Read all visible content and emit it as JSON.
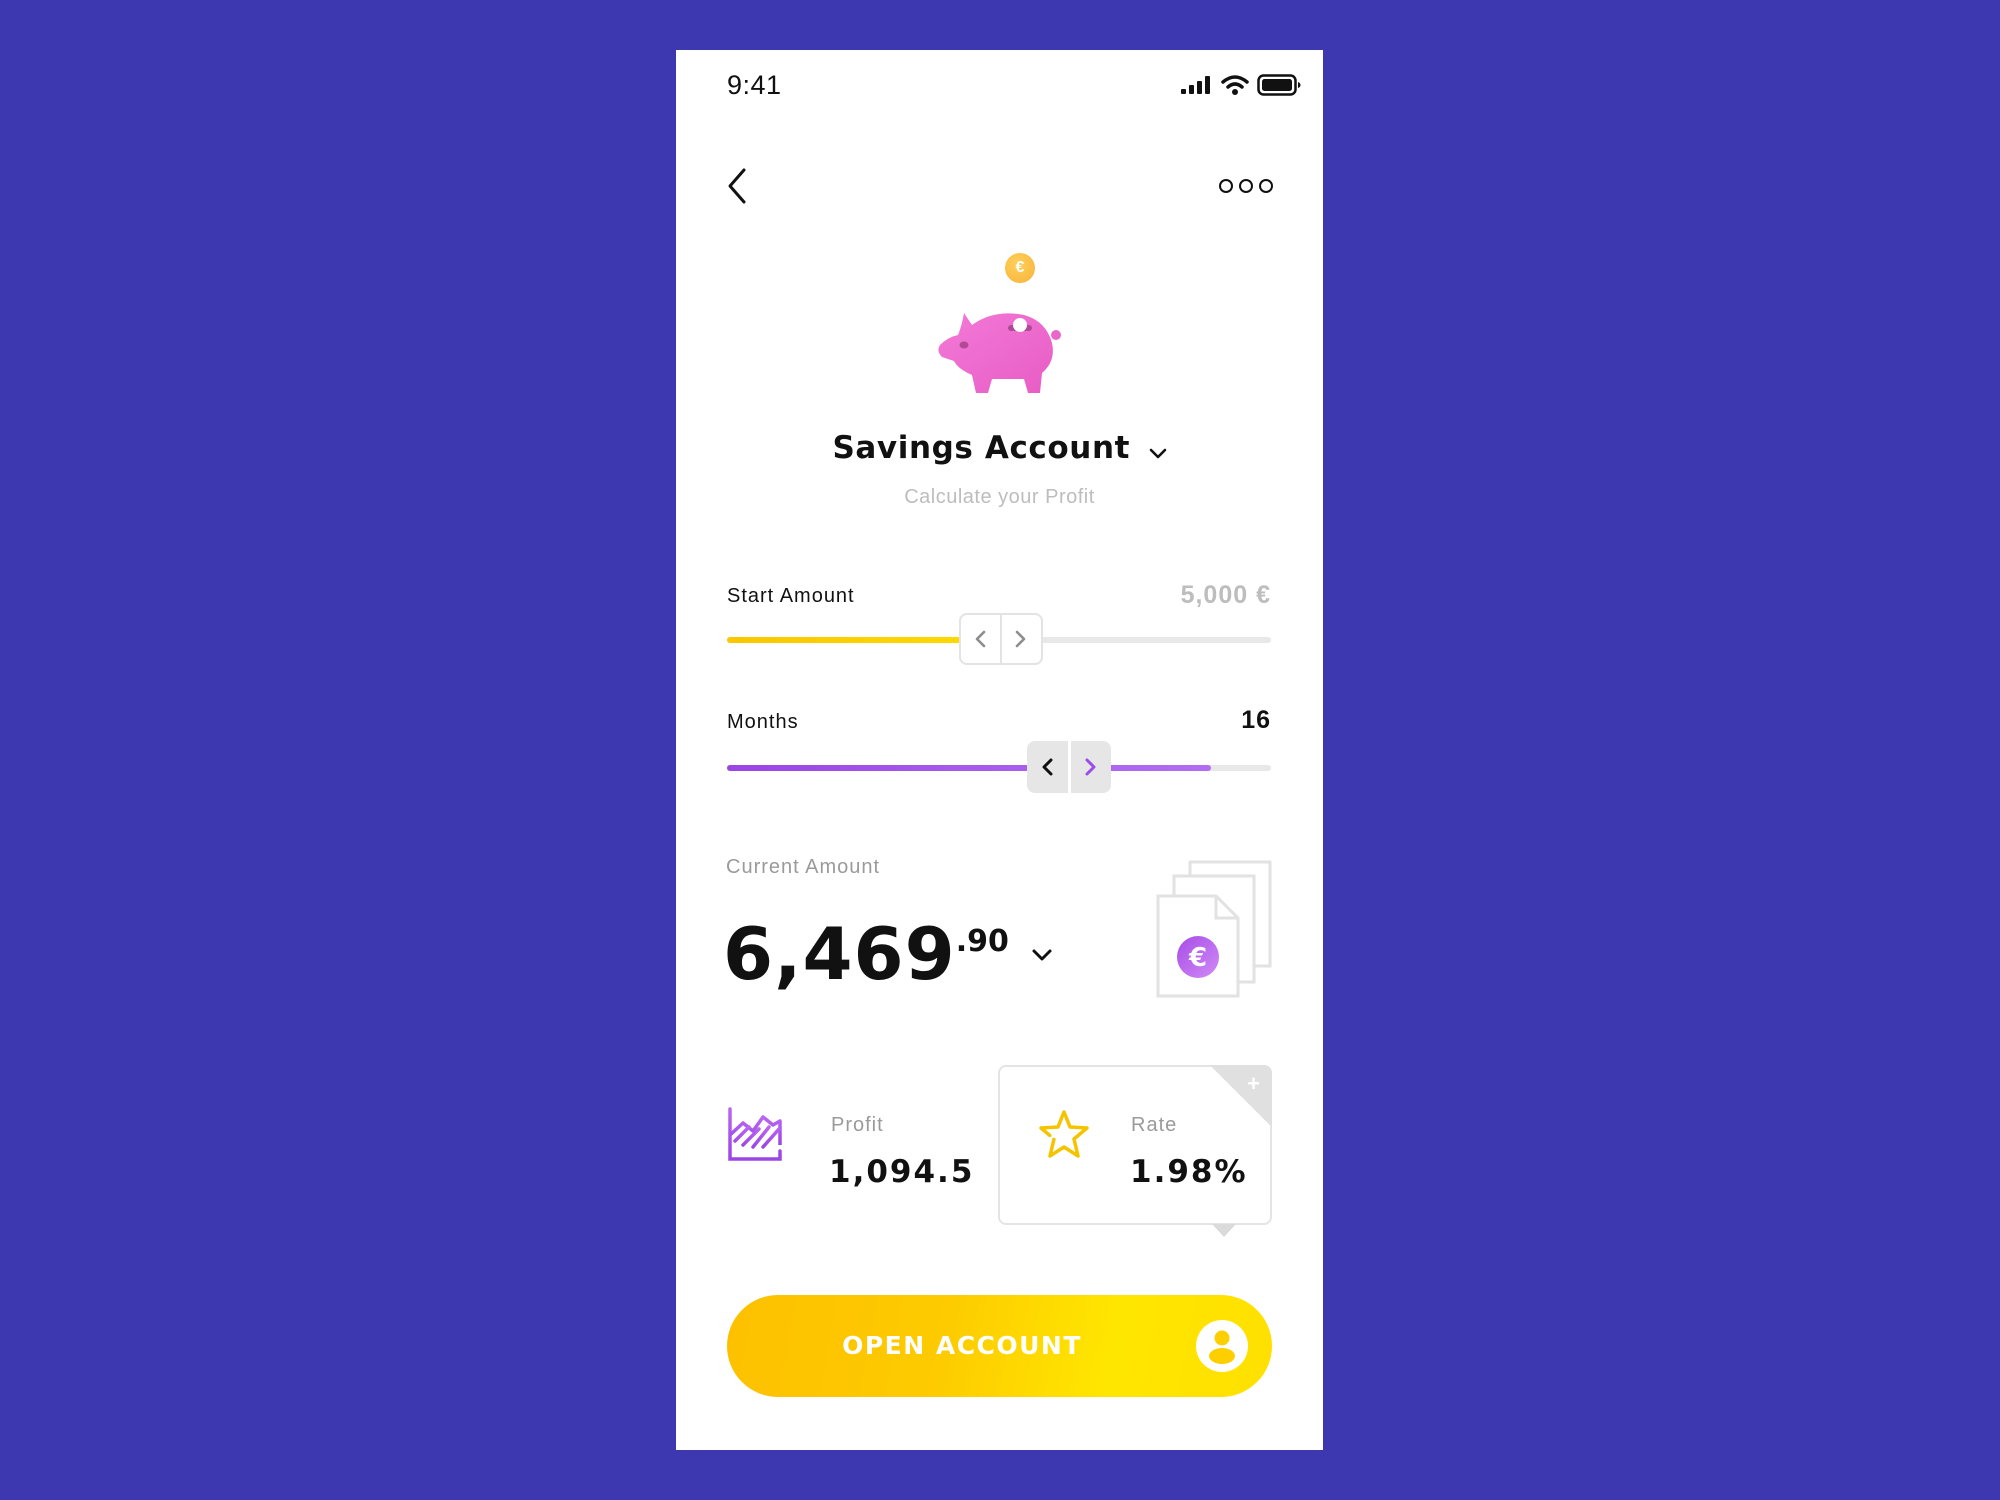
{
  "status_bar": {
    "time": "9:41",
    "icons": [
      "cellular-signal-icon",
      "wifi-icon",
      "battery-icon"
    ]
  },
  "nav": {
    "back_icon": "chevron-left-icon",
    "more_icon": "more-horizontal-icon"
  },
  "hero": {
    "illustration": "piggy-bank-icon",
    "coin_symbol": "€",
    "title": "Savings Account",
    "subtitle": "Calculate your Profit"
  },
  "sliders": [
    {
      "label": "Start Amount",
      "value": "5,000 €",
      "fill_fraction": 0.43,
      "state": "inactive",
      "accent": "#ffc800"
    },
    {
      "label": "Months",
      "value": "16",
      "fill_fraction": 0.89,
      "state": "active",
      "accent": "#9b4de8"
    }
  ],
  "current_amount": {
    "label": "Current Amount",
    "integer": "6,469",
    "decimal": ".90",
    "currency_symbol": "€"
  },
  "stats": {
    "profit": {
      "label": "Profit",
      "value": "1,094.5"
    },
    "rate": {
      "label": "Rate",
      "value": "1.98%",
      "corner_symbol": "+"
    }
  },
  "cta": {
    "label": "OPEN ACCOUNT"
  },
  "colors": {
    "background": "#3d38b0",
    "yellow": "#ffc800",
    "purple": "#9b4de8",
    "pink": "#f06ed0"
  }
}
